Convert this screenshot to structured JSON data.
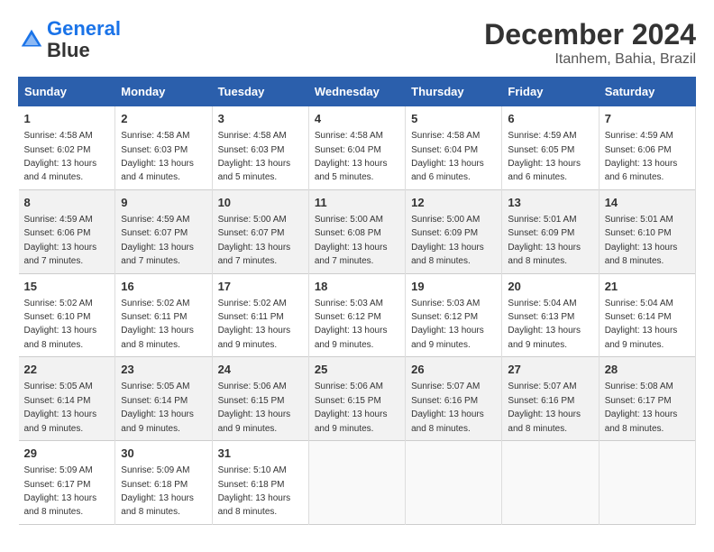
{
  "header": {
    "logo_line1": "General",
    "logo_line2": "Blue",
    "month": "December 2024",
    "location": "Itanhem, Bahia, Brazil"
  },
  "weekdays": [
    "Sunday",
    "Monday",
    "Tuesday",
    "Wednesday",
    "Thursday",
    "Friday",
    "Saturday"
  ],
  "weeks": [
    [
      {
        "day": "1",
        "sunrise": "4:58 AM",
        "sunset": "6:02 PM",
        "daylight": "13 hours and 4 minutes."
      },
      {
        "day": "2",
        "sunrise": "4:58 AM",
        "sunset": "6:03 PM",
        "daylight": "13 hours and 4 minutes."
      },
      {
        "day": "3",
        "sunrise": "4:58 AM",
        "sunset": "6:03 PM",
        "daylight": "13 hours and 5 minutes."
      },
      {
        "day": "4",
        "sunrise": "4:58 AM",
        "sunset": "6:04 PM",
        "daylight": "13 hours and 5 minutes."
      },
      {
        "day": "5",
        "sunrise": "4:58 AM",
        "sunset": "6:04 PM",
        "daylight": "13 hours and 6 minutes."
      },
      {
        "day": "6",
        "sunrise": "4:59 AM",
        "sunset": "6:05 PM",
        "daylight": "13 hours and 6 minutes."
      },
      {
        "day": "7",
        "sunrise": "4:59 AM",
        "sunset": "6:06 PM",
        "daylight": "13 hours and 6 minutes."
      }
    ],
    [
      {
        "day": "8",
        "sunrise": "4:59 AM",
        "sunset": "6:06 PM",
        "daylight": "13 hours and 7 minutes."
      },
      {
        "day": "9",
        "sunrise": "4:59 AM",
        "sunset": "6:07 PM",
        "daylight": "13 hours and 7 minutes."
      },
      {
        "day": "10",
        "sunrise": "5:00 AM",
        "sunset": "6:07 PM",
        "daylight": "13 hours and 7 minutes."
      },
      {
        "day": "11",
        "sunrise": "5:00 AM",
        "sunset": "6:08 PM",
        "daylight": "13 hours and 7 minutes."
      },
      {
        "day": "12",
        "sunrise": "5:00 AM",
        "sunset": "6:09 PM",
        "daylight": "13 hours and 8 minutes."
      },
      {
        "day": "13",
        "sunrise": "5:01 AM",
        "sunset": "6:09 PM",
        "daylight": "13 hours and 8 minutes."
      },
      {
        "day": "14",
        "sunrise": "5:01 AM",
        "sunset": "6:10 PM",
        "daylight": "13 hours and 8 minutes."
      }
    ],
    [
      {
        "day": "15",
        "sunrise": "5:02 AM",
        "sunset": "6:10 PM",
        "daylight": "13 hours and 8 minutes."
      },
      {
        "day": "16",
        "sunrise": "5:02 AM",
        "sunset": "6:11 PM",
        "daylight": "13 hours and 8 minutes."
      },
      {
        "day": "17",
        "sunrise": "5:02 AM",
        "sunset": "6:11 PM",
        "daylight": "13 hours and 9 minutes."
      },
      {
        "day": "18",
        "sunrise": "5:03 AM",
        "sunset": "6:12 PM",
        "daylight": "13 hours and 9 minutes."
      },
      {
        "day": "19",
        "sunrise": "5:03 AM",
        "sunset": "6:12 PM",
        "daylight": "13 hours and 9 minutes."
      },
      {
        "day": "20",
        "sunrise": "5:04 AM",
        "sunset": "6:13 PM",
        "daylight": "13 hours and 9 minutes."
      },
      {
        "day": "21",
        "sunrise": "5:04 AM",
        "sunset": "6:14 PM",
        "daylight": "13 hours and 9 minutes."
      }
    ],
    [
      {
        "day": "22",
        "sunrise": "5:05 AM",
        "sunset": "6:14 PM",
        "daylight": "13 hours and 9 minutes."
      },
      {
        "day": "23",
        "sunrise": "5:05 AM",
        "sunset": "6:14 PM",
        "daylight": "13 hours and 9 minutes."
      },
      {
        "day": "24",
        "sunrise": "5:06 AM",
        "sunset": "6:15 PM",
        "daylight": "13 hours and 9 minutes."
      },
      {
        "day": "25",
        "sunrise": "5:06 AM",
        "sunset": "6:15 PM",
        "daylight": "13 hours and 9 minutes."
      },
      {
        "day": "26",
        "sunrise": "5:07 AM",
        "sunset": "6:16 PM",
        "daylight": "13 hours and 8 minutes."
      },
      {
        "day": "27",
        "sunrise": "5:07 AM",
        "sunset": "6:16 PM",
        "daylight": "13 hours and 8 minutes."
      },
      {
        "day": "28",
        "sunrise": "5:08 AM",
        "sunset": "6:17 PM",
        "daylight": "13 hours and 8 minutes."
      }
    ],
    [
      {
        "day": "29",
        "sunrise": "5:09 AM",
        "sunset": "6:17 PM",
        "daylight": "13 hours and 8 minutes."
      },
      {
        "day": "30",
        "sunrise": "5:09 AM",
        "sunset": "6:18 PM",
        "daylight": "13 hours and 8 minutes."
      },
      {
        "day": "31",
        "sunrise": "5:10 AM",
        "sunset": "6:18 PM",
        "daylight": "13 hours and 8 minutes."
      },
      null,
      null,
      null,
      null
    ]
  ]
}
